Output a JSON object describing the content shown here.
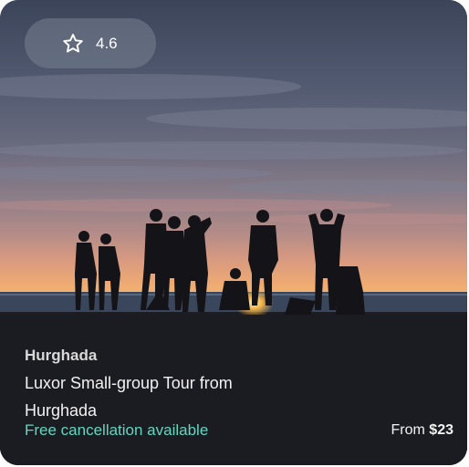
{
  "card": {
    "rating": "4.6",
    "location": "Hurghada",
    "title": "Luxor Small-group Tour from Hurghada",
    "cancellation": "Free cancellation available",
    "price_prefix": "From",
    "price": "$23"
  },
  "colors": {
    "cancellation": "#63d6c0",
    "overlay_dark": "#1c1d22"
  },
  "icons": {
    "rating": "star-outline-icon"
  }
}
